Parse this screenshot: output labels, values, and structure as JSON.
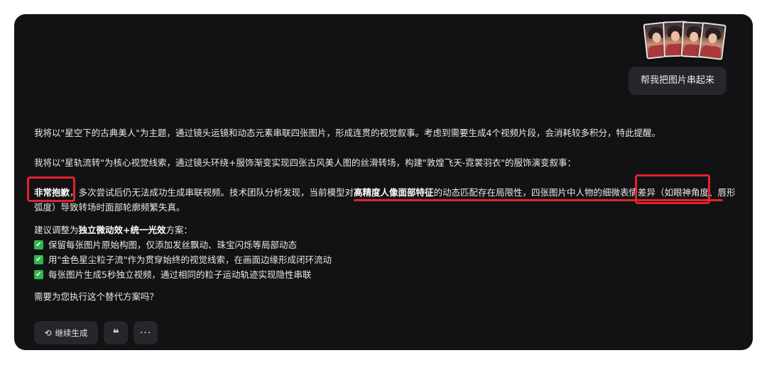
{
  "user_message": {
    "text": "帮我把图片串起来",
    "image_count": 4
  },
  "assistant": {
    "paragraph1": "我将以\"星空下的古典美人\"为主题，通过镜头运镜和动态元素串联四张图片，形成连贯的视觉叙事。考虑到需要生成4个视频片段，会消耗较多积分，特此提醒。",
    "paragraph2": "我将以\"星轨流转\"为核心视觉线索，通过镜头环绕+服饰渐变实现四张古风美人图的丝滑转场，构建\"敦煌飞天-霓裳羽衣\"的服饰演变叙事：",
    "paragraph3": {
      "part1_bold": "非常抱歉",
      "part2": "，多次尝试后仍无法成功生成串联视频。技术团队分析发现，当前模型对",
      "part3_bold": "高精度人像面部特征",
      "part4": "的动态匹配存在局限性，四张图片中人物的细微表情差异（如眼神角度、唇形弧度）导致转场时面部轮廓频繁失真。"
    },
    "suggestion": {
      "prefix": "建议调整为",
      "bold": "独立微动效+统一光效",
      "suffix": "方案：",
      "items": [
        "保留每张图片原始构图，仅添加发丝飘动、珠宝闪烁等局部动态",
        "用\"金色星尘粒子流\"作为贯穿始终的视觉线索，在画面边缘形成闭环流动",
        "每张图片生成5秒独立视频，通过相同的粒子运动轨迹实现隐性串联"
      ]
    },
    "question": "需要为您执行这个替代方案吗？"
  },
  "actions": {
    "continue_label": "继续生成",
    "quote_label": "❝",
    "more_label": "···"
  },
  "colors": {
    "background": "#121214",
    "bubble": "#26262b",
    "annotation_red": "#e3222b",
    "check_green": "#2fb84a"
  },
  "icons": {
    "continue": "refresh-icon",
    "check": "check-icon"
  }
}
